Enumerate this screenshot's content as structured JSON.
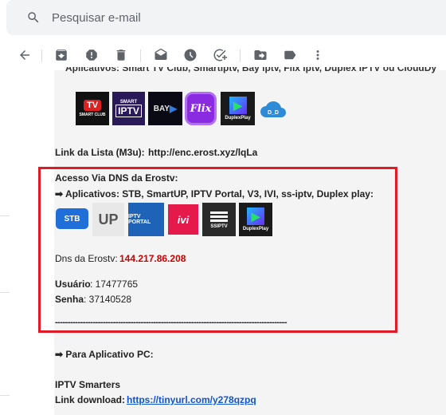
{
  "search": {
    "placeholder": "Pesquisar e-mail"
  },
  "toolbar": {
    "items": [
      "back",
      "archive",
      "report-spam",
      "delete",
      "mark-unread",
      "snooze",
      "add-to-tasks",
      "move-to",
      "labels",
      "more"
    ]
  },
  "email": {
    "cut_line": "Aplicativos: Smart TV Club, SmartIptv, Bay iptv, Flix iptv, Duplex IPTV ou CloudDy",
    "top_apps": [
      {
        "icon": "smart-tv-club-icon",
        "label": "TV",
        "sub": "SMART CLUB",
        "color": "#111111"
      },
      {
        "icon": "smart-iptv-icon",
        "label": "IPTV",
        "sub": "SMART",
        "color": "#2b1a5a"
      },
      {
        "icon": "bay-iptv-icon",
        "label": "BAY",
        "sub": "",
        "color": "#0a0a14"
      },
      {
        "icon": "flix-iptv-icon",
        "label": "Flix",
        "sub": "",
        "color": "#8a2be2"
      },
      {
        "icon": "duplex-play-icon",
        "label": "DuplexPlay",
        "sub": "",
        "color": "#1a1a1a"
      },
      {
        "icon": "cloud-ddy-icon",
        "label": "D_D",
        "sub": "",
        "color": "#2e8bd8"
      }
    ],
    "list_link_label": "Link da Lista (M3u):",
    "list_link_value": "http://enc.erost.xyz/lqLa",
    "dns_heading": "Acesso Via DNS da Erostv:",
    "dns_apps_line": "➡ Aplicativos: STB, SmartUP, IPTV Portal, V3, IVI, ss-iptv, Duplex play:",
    "dns_apps": [
      {
        "icon": "stb-icon",
        "label": "STB",
        "color": "#1e6fd9"
      },
      {
        "icon": "smartup-icon",
        "label": "SMART UP",
        "color": "#dddddd"
      },
      {
        "icon": "iptv-portal-icon",
        "label": "IPTV PORTAL",
        "color": "#1f63b8"
      },
      {
        "icon": "ivi-icon",
        "label": "ivi",
        "color": "#e6194b"
      },
      {
        "icon": "ss-iptv-icon",
        "label": "SSIPTV",
        "color": "#2a2a2a"
      },
      {
        "icon": "duplex-play-icon",
        "label": "DuplexPlay",
        "color": "#1a1a1a"
      }
    ],
    "dns_label": "Dns da Erostv:",
    "dns_value": "144.217.86.208",
    "user_label": "Usuário",
    "user_value": ": 17477765",
    "pass_label": "Senha",
    "pass_value": ": 37140528",
    "divider": "--------------------------------------------------------------------------------------------",
    "pc_heading": "➡ Para Aplicativo PC:",
    "pc_app": "IPTV Smarters",
    "download_label": "Link download:",
    "download_value": "https://tinyurl.com/y278qzpq"
  },
  "colors": {
    "highlight_border": "#e01b24",
    "dns_value": "#cc0000",
    "link": "#1155cc"
  }
}
